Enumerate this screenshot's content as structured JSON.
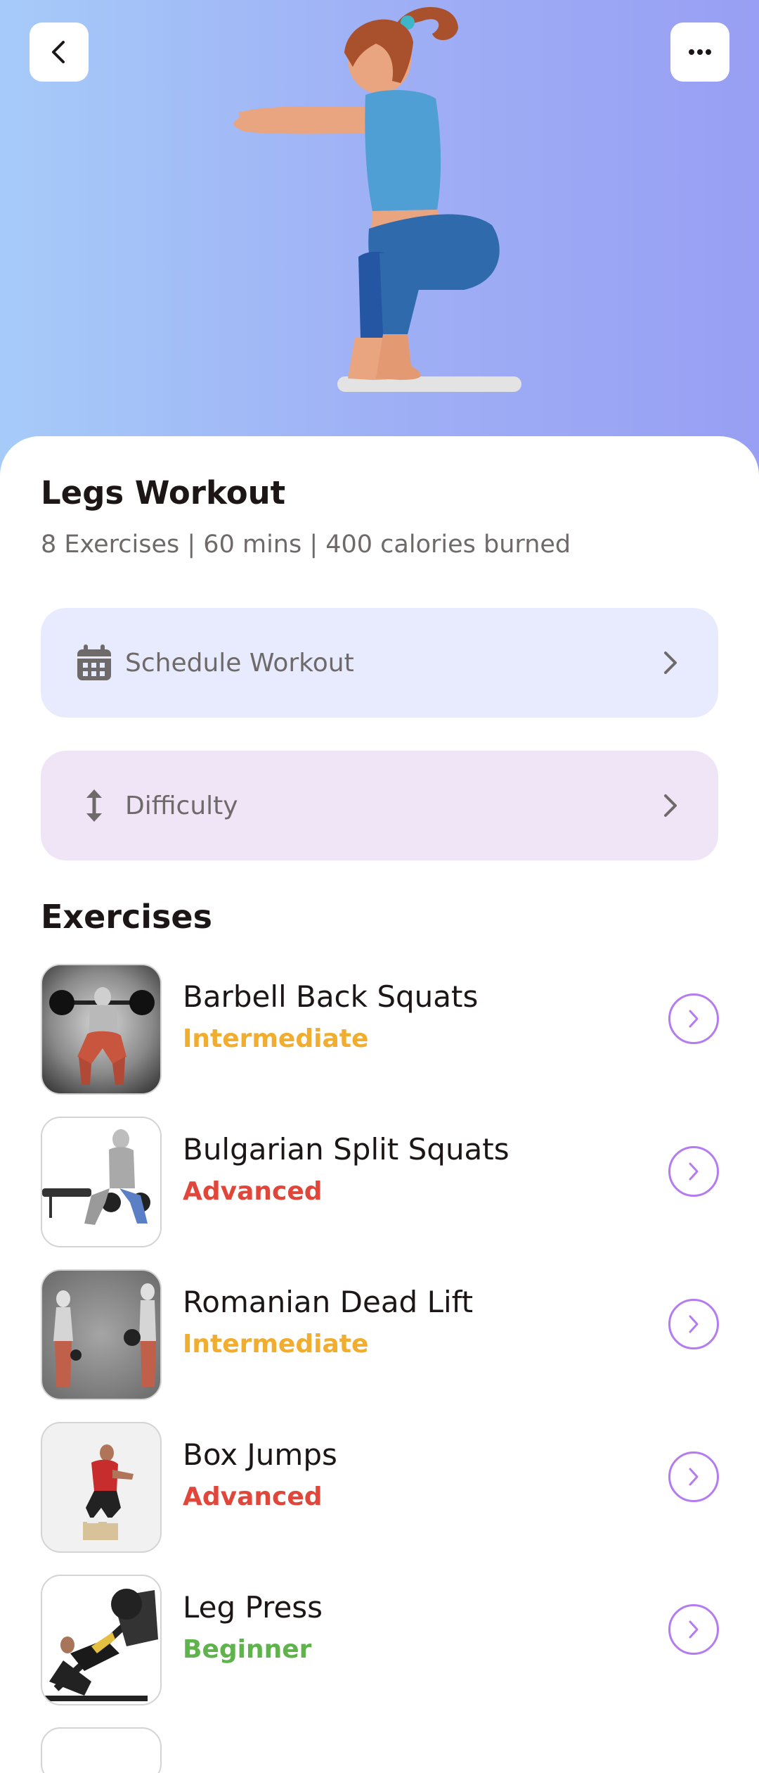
{
  "header": {
    "back_icon": "chevron-left-icon",
    "more_icon": "ellipsis-icon"
  },
  "workout": {
    "title": "Legs Workout",
    "subtitle": "8 Exercises | 60 mins | 400 calories burned"
  },
  "actions": {
    "schedule": {
      "label": "Schedule Workout",
      "icon": "calendar-icon"
    },
    "difficulty": {
      "label": "Difficulty",
      "icon": "up-down-arrow-icon"
    }
  },
  "exercises_section": {
    "title": "Exercises",
    "items": [
      {
        "name": "Barbell Back Squats",
        "level": "Intermediate",
        "level_color": "#f0ad2f"
      },
      {
        "name": "Bulgarian Split Squats",
        "level": "Advanced",
        "level_color": "#e0463a"
      },
      {
        "name": "Romanian Dead Lift",
        "level": "Intermediate",
        "level_color": "#f0ad2f"
      },
      {
        "name": "Box Jumps",
        "level": "Advanced",
        "level_color": "#e0463a"
      },
      {
        "name": "Leg Press",
        "level": "Beginner",
        "level_color": "#5fb34c"
      }
    ]
  },
  "colors": {
    "hero_gradient_start": "#a6cbf9",
    "hero_gradient_end": "#989ff4",
    "schedule_bg": "#e8ebfd",
    "difficulty_bg": "#efe5f7",
    "accent_purple": "#b47cf0"
  }
}
